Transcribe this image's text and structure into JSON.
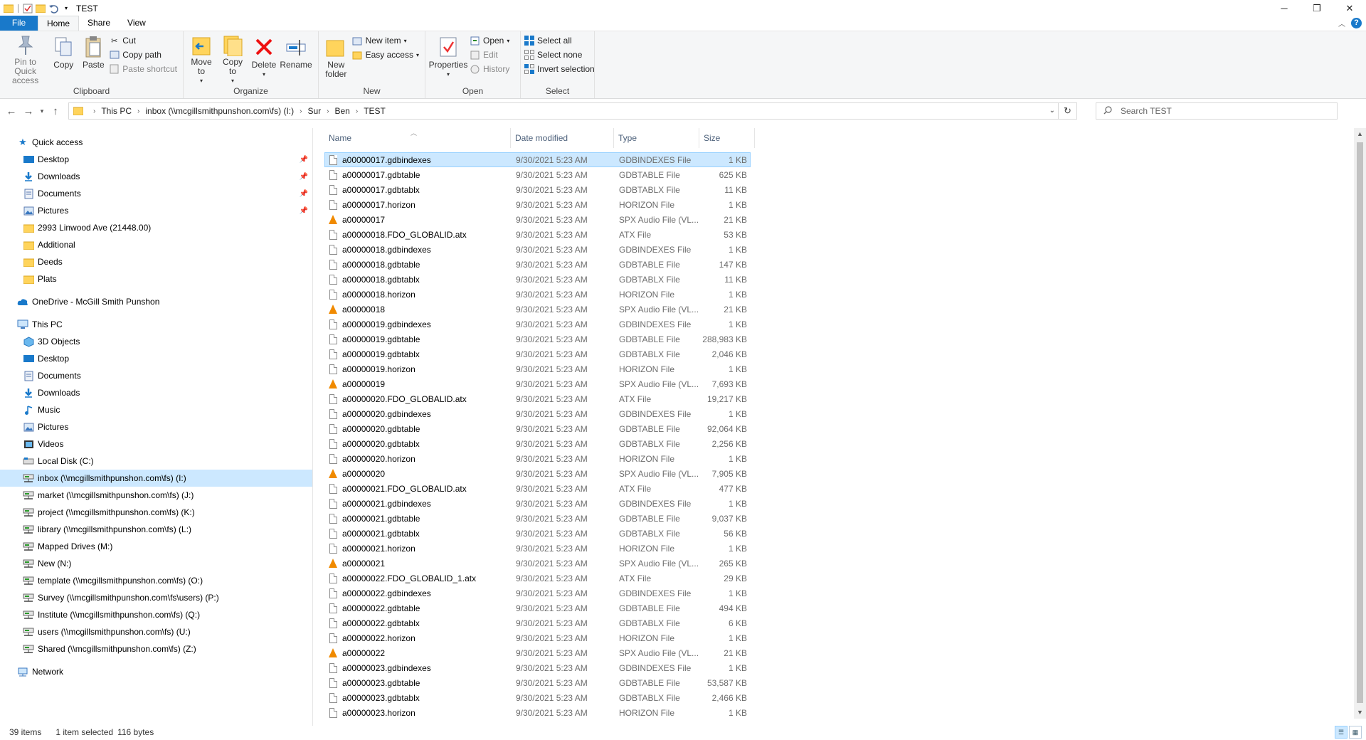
{
  "window": {
    "title": "TEST",
    "controls": {
      "minimize": "─",
      "restore": "❐",
      "close": "✕"
    }
  },
  "ribbon_tabs": [
    "File",
    "Home",
    "Share",
    "View"
  ],
  "ribbon": {
    "clipboard": {
      "label": "Clipboard",
      "pin": "Pin to Quick access",
      "copy": "Copy",
      "paste": "Paste",
      "cut": "Cut",
      "copy_path": "Copy path",
      "paste_shortcut": "Paste shortcut"
    },
    "organize": {
      "label": "Organize",
      "move_to": "Move to",
      "copy_to": "Copy to",
      "delete": "Delete",
      "rename": "Rename"
    },
    "new": {
      "label": "New",
      "new_folder": "New folder",
      "new_item": "New item",
      "easy_access": "Easy access"
    },
    "open": {
      "label": "Open",
      "properties": "Properties",
      "open": "Open",
      "edit": "Edit",
      "history": "History"
    },
    "select": {
      "label": "Select",
      "select_all": "Select all",
      "select_none": "Select none",
      "invert": "Invert selection"
    }
  },
  "address": {
    "crumbs": [
      "This PC",
      "inbox (\\\\mcgillsmithpunshon.com\\fs) (I:)",
      "Sur",
      "Ben",
      "TEST"
    ],
    "search_placeholder": "Search TEST"
  },
  "nav": {
    "quick_access": "Quick access",
    "quick_items": [
      {
        "label": "Desktop",
        "icon": "desktop-icon",
        "pinned": true
      },
      {
        "label": "Downloads",
        "icon": "downloads-icon",
        "pinned": true
      },
      {
        "label": "Documents",
        "icon": "documents-icon",
        "pinned": true
      },
      {
        "label": "Pictures",
        "icon": "pictures-icon",
        "pinned": true
      },
      {
        "label": "2993 Linwood Ave (21448.00)",
        "icon": "folder-icon",
        "pinned": false
      },
      {
        "label": "Additional",
        "icon": "folder-icon",
        "pinned": false
      },
      {
        "label": "Deeds",
        "icon": "folder-icon",
        "pinned": false
      },
      {
        "label": "Plats",
        "icon": "folder-icon",
        "pinned": false
      }
    ],
    "onedrive": "OneDrive - McGill Smith Punshon",
    "this_pc": "This PC",
    "pc_items": [
      {
        "label": "3D Objects",
        "icon": "3d-objects-icon"
      },
      {
        "label": "Desktop",
        "icon": "desktop-icon"
      },
      {
        "label": "Documents",
        "icon": "documents-icon"
      },
      {
        "label": "Downloads",
        "icon": "downloads-icon"
      },
      {
        "label": "Music",
        "icon": "music-icon"
      },
      {
        "label": "Pictures",
        "icon": "pictures-icon"
      },
      {
        "label": "Videos",
        "icon": "videos-icon"
      },
      {
        "label": "Local Disk (C:)",
        "icon": "local-disk-icon"
      },
      {
        "label": "inbox (\\\\mcgillsmithpunshon.com\\fs) (I:)",
        "icon": "network-drive-icon",
        "selected": true
      },
      {
        "label": "market (\\\\mcgillsmithpunshon.com\\fs) (J:)",
        "icon": "network-drive-icon"
      },
      {
        "label": "project (\\\\mcgillsmithpunshon.com\\fs) (K:)",
        "icon": "network-drive-icon"
      },
      {
        "label": "library (\\\\mcgillsmithpunshon.com\\fs) (L:)",
        "icon": "network-drive-icon"
      },
      {
        "label": "Mapped Drives (M:)",
        "icon": "network-drive-icon"
      },
      {
        "label": "New (N:)",
        "icon": "network-drive-icon"
      },
      {
        "label": "template (\\\\mcgillsmithpunshon.com\\fs) (O:)",
        "icon": "network-drive-icon"
      },
      {
        "label": "Survey (\\\\mcgillsmithpunshon.com\\fs\\users) (P:)",
        "icon": "network-drive-icon"
      },
      {
        "label": "Institute (\\\\mcgillsmithpunshon.com\\fs) (Q:)",
        "icon": "network-drive-icon"
      },
      {
        "label": "users (\\\\mcgillsmithpunshon.com\\fs) (U:)",
        "icon": "network-drive-icon"
      },
      {
        "label": "Shared (\\\\mcgillsmithpunshon.com\\fs) (Z:)",
        "icon": "network-drive-icon"
      }
    ],
    "network": "Network"
  },
  "columns": {
    "name": "Name",
    "date": "Date modified",
    "type": "Type",
    "size": "Size"
  },
  "files": [
    {
      "name": "a00000017.gdbindexes",
      "date": "9/30/2021 5:23 AM",
      "type": "GDBINDEXES File",
      "size": "1 KB",
      "icon": "file-icon",
      "selected": true
    },
    {
      "name": "a00000017.gdbtable",
      "date": "9/30/2021 5:23 AM",
      "type": "GDBTABLE File",
      "size": "625 KB",
      "icon": "file-icon"
    },
    {
      "name": "a00000017.gdbtablx",
      "date": "9/30/2021 5:23 AM",
      "type": "GDBTABLX File",
      "size": "11 KB",
      "icon": "file-icon"
    },
    {
      "name": "a00000017.horizon",
      "date": "9/30/2021 5:23 AM",
      "type": "HORIZON File",
      "size": "1 KB",
      "icon": "file-icon"
    },
    {
      "name": "a00000017",
      "date": "9/30/2021 5:23 AM",
      "type": "SPX Audio File (VL...",
      "size": "21 KB",
      "icon": "vlc-icon"
    },
    {
      "name": "a00000018.FDO_GLOBALID.atx",
      "date": "9/30/2021 5:23 AM",
      "type": "ATX File",
      "size": "53 KB",
      "icon": "file-icon"
    },
    {
      "name": "a00000018.gdbindexes",
      "date": "9/30/2021 5:23 AM",
      "type": "GDBINDEXES File",
      "size": "1 KB",
      "icon": "file-icon"
    },
    {
      "name": "a00000018.gdbtable",
      "date": "9/30/2021 5:23 AM",
      "type": "GDBTABLE File",
      "size": "147 KB",
      "icon": "file-icon"
    },
    {
      "name": "a00000018.gdbtablx",
      "date": "9/30/2021 5:23 AM",
      "type": "GDBTABLX File",
      "size": "11 KB",
      "icon": "file-icon"
    },
    {
      "name": "a00000018.horizon",
      "date": "9/30/2021 5:23 AM",
      "type": "HORIZON File",
      "size": "1 KB",
      "icon": "file-icon"
    },
    {
      "name": "a00000018",
      "date": "9/30/2021 5:23 AM",
      "type": "SPX Audio File (VL...",
      "size": "21 KB",
      "icon": "vlc-icon"
    },
    {
      "name": "a00000019.gdbindexes",
      "date": "9/30/2021 5:23 AM",
      "type": "GDBINDEXES File",
      "size": "1 KB",
      "icon": "file-icon"
    },
    {
      "name": "a00000019.gdbtable",
      "date": "9/30/2021 5:23 AM",
      "type": "GDBTABLE File",
      "size": "288,983 KB",
      "icon": "file-icon"
    },
    {
      "name": "a00000019.gdbtablx",
      "date": "9/30/2021 5:23 AM",
      "type": "GDBTABLX File",
      "size": "2,046 KB",
      "icon": "file-icon"
    },
    {
      "name": "a00000019.horizon",
      "date": "9/30/2021 5:23 AM",
      "type": "HORIZON File",
      "size": "1 KB",
      "icon": "file-icon"
    },
    {
      "name": "a00000019",
      "date": "9/30/2021 5:23 AM",
      "type": "SPX Audio File (VL...",
      "size": "7,693 KB",
      "icon": "vlc-icon"
    },
    {
      "name": "a00000020.FDO_GLOBALID.atx",
      "date": "9/30/2021 5:23 AM",
      "type": "ATX File",
      "size": "19,217 KB",
      "icon": "file-icon"
    },
    {
      "name": "a00000020.gdbindexes",
      "date": "9/30/2021 5:23 AM",
      "type": "GDBINDEXES File",
      "size": "1 KB",
      "icon": "file-icon"
    },
    {
      "name": "a00000020.gdbtable",
      "date": "9/30/2021 5:23 AM",
      "type": "GDBTABLE File",
      "size": "92,064 KB",
      "icon": "file-icon"
    },
    {
      "name": "a00000020.gdbtablx",
      "date": "9/30/2021 5:23 AM",
      "type": "GDBTABLX File",
      "size": "2,256 KB",
      "icon": "file-icon"
    },
    {
      "name": "a00000020.horizon",
      "date": "9/30/2021 5:23 AM",
      "type": "HORIZON File",
      "size": "1 KB",
      "icon": "file-icon"
    },
    {
      "name": "a00000020",
      "date": "9/30/2021 5:23 AM",
      "type": "SPX Audio File (VL...",
      "size": "7,905 KB",
      "icon": "vlc-icon"
    },
    {
      "name": "a00000021.FDO_GLOBALID.atx",
      "date": "9/30/2021 5:23 AM",
      "type": "ATX File",
      "size": "477 KB",
      "icon": "file-icon"
    },
    {
      "name": "a00000021.gdbindexes",
      "date": "9/30/2021 5:23 AM",
      "type": "GDBINDEXES File",
      "size": "1 KB",
      "icon": "file-icon"
    },
    {
      "name": "a00000021.gdbtable",
      "date": "9/30/2021 5:23 AM",
      "type": "GDBTABLE File",
      "size": "9,037 KB",
      "icon": "file-icon"
    },
    {
      "name": "a00000021.gdbtablx",
      "date": "9/30/2021 5:23 AM",
      "type": "GDBTABLX File",
      "size": "56 KB",
      "icon": "file-icon"
    },
    {
      "name": "a00000021.horizon",
      "date": "9/30/2021 5:23 AM",
      "type": "HORIZON File",
      "size": "1 KB",
      "icon": "file-icon"
    },
    {
      "name": "a00000021",
      "date": "9/30/2021 5:23 AM",
      "type": "SPX Audio File (VL...",
      "size": "265 KB",
      "icon": "vlc-icon"
    },
    {
      "name": "a00000022.FDO_GLOBALID_1.atx",
      "date": "9/30/2021 5:23 AM",
      "type": "ATX File",
      "size": "29 KB",
      "icon": "file-icon"
    },
    {
      "name": "a00000022.gdbindexes",
      "date": "9/30/2021 5:23 AM",
      "type": "GDBINDEXES File",
      "size": "1 KB",
      "icon": "file-icon"
    },
    {
      "name": "a00000022.gdbtable",
      "date": "9/30/2021 5:23 AM",
      "type": "GDBTABLE File",
      "size": "494 KB",
      "icon": "file-icon"
    },
    {
      "name": "a00000022.gdbtablx",
      "date": "9/30/2021 5:23 AM",
      "type": "GDBTABLX File",
      "size": "6 KB",
      "icon": "file-icon"
    },
    {
      "name": "a00000022.horizon",
      "date": "9/30/2021 5:23 AM",
      "type": "HORIZON File",
      "size": "1 KB",
      "icon": "file-icon"
    },
    {
      "name": "a00000022",
      "date": "9/30/2021 5:23 AM",
      "type": "SPX Audio File (VL...",
      "size": "21 KB",
      "icon": "vlc-icon"
    },
    {
      "name": "a00000023.gdbindexes",
      "date": "9/30/2021 5:23 AM",
      "type": "GDBINDEXES File",
      "size": "1 KB",
      "icon": "file-icon"
    },
    {
      "name": "a00000023.gdbtable",
      "date": "9/30/2021 5:23 AM",
      "type": "GDBTABLE File",
      "size": "53,587 KB",
      "icon": "file-icon"
    },
    {
      "name": "a00000023.gdbtablx",
      "date": "9/30/2021 5:23 AM",
      "type": "GDBTABLX File",
      "size": "2,466 KB",
      "icon": "file-icon"
    },
    {
      "name": "a00000023.horizon",
      "date": "9/30/2021 5:23 AM",
      "type": "HORIZON File",
      "size": "1 KB",
      "icon": "file-icon"
    }
  ],
  "status": {
    "item_count": "39 items",
    "selection": "1 item selected",
    "selection_size": "116 bytes"
  },
  "colors": {
    "accent": "#1979ca",
    "selection": "#cce8ff",
    "folder": "#ffd45c",
    "vlc": "#f08a00"
  }
}
